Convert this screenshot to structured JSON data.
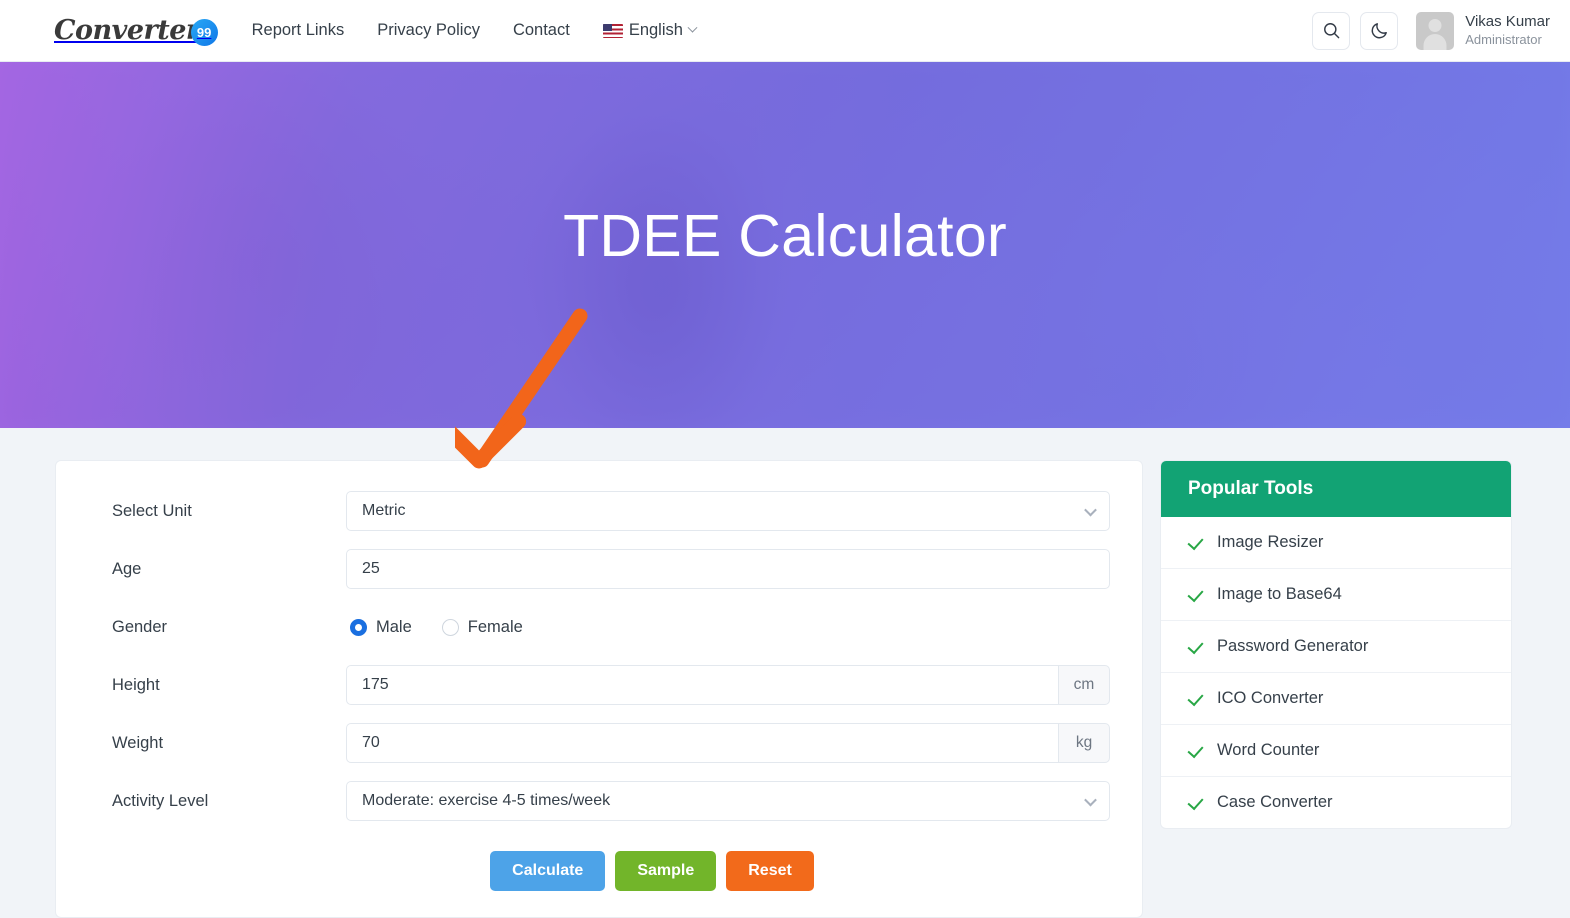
{
  "header": {
    "logo": {
      "text": "Converter",
      "badge": "99"
    },
    "nav": [
      {
        "label": "Report Links"
      },
      {
        "label": "Privacy Policy"
      },
      {
        "label": "Contact"
      }
    ],
    "language": {
      "label": "English",
      "flag_icon": "us-flag-icon"
    },
    "search_icon": "search-icon",
    "theme_icon": "moon-icon",
    "user": {
      "name": "Vikas Kumar",
      "role": "Administrator"
    }
  },
  "hero": {
    "title": "TDEE Calculator",
    "annotation": {
      "type": "arrow",
      "color": "#f2651a",
      "direction": "down-left"
    }
  },
  "form": {
    "unit": {
      "label": "Select Unit",
      "value": "Metric"
    },
    "age": {
      "label": "Age",
      "value": "25"
    },
    "gender": {
      "label": "Gender",
      "options": [
        {
          "label": "Male",
          "selected": true
        },
        {
          "label": "Female",
          "selected": false
        }
      ]
    },
    "height": {
      "label": "Height",
      "value": "175",
      "unit": "cm"
    },
    "weight": {
      "label": "Weight",
      "value": "70",
      "unit": "kg"
    },
    "activity": {
      "label": "Activity Level",
      "value": "Moderate: exercise 4-5 times/week"
    },
    "buttons": {
      "calculate": "Calculate",
      "sample": "Sample",
      "reset": "Reset"
    }
  },
  "sidebar": {
    "title": "Popular Tools",
    "items": [
      {
        "label": "Image Resizer"
      },
      {
        "label": "Image to Base64"
      },
      {
        "label": "Password Generator"
      },
      {
        "label": "ICO Converter"
      },
      {
        "label": "Word Counter"
      },
      {
        "label": "Case Converter"
      }
    ]
  },
  "colors": {
    "accent_purple": "#6f64e4",
    "sidebar_green": "#12a374",
    "calculate_blue": "#4da3e8",
    "sample_green": "#72b52a",
    "reset_orange": "#f26a1b",
    "radio_blue": "#1a6fe0",
    "check_green": "#28a745",
    "page_bg": "#f1f4f8"
  }
}
